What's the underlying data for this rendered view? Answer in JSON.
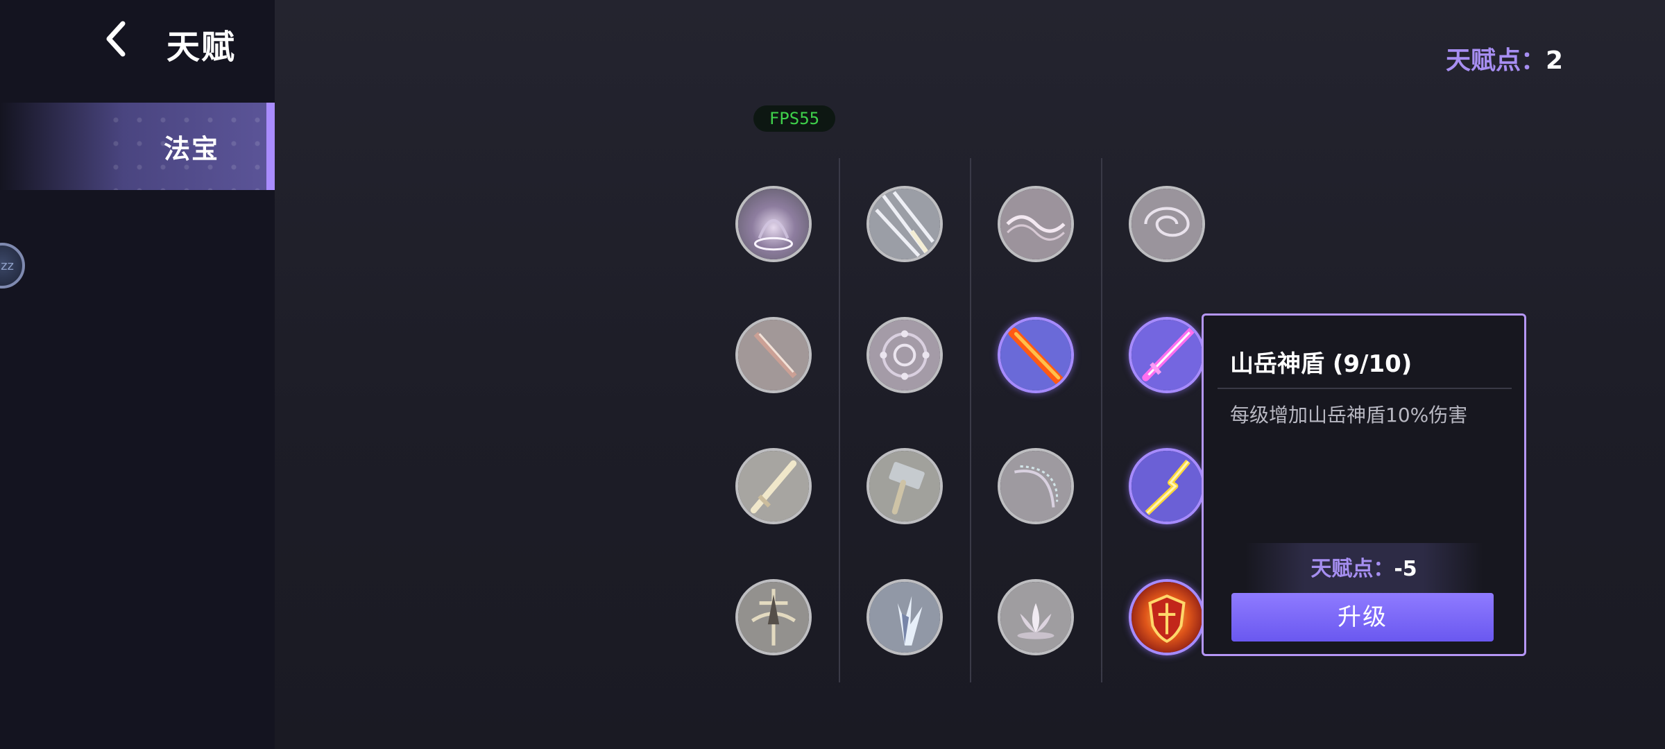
{
  "header": {
    "title": "天赋"
  },
  "sidebar": {
    "tabs": [
      {
        "label": "法宝"
      }
    ],
    "orb_text": "zz"
  },
  "talent_points": {
    "label": "天赋点：",
    "value": "2"
  },
  "fps": "FPS55",
  "nodes": [
    {
      "icon": "purple-vortex-icon",
      "state": "locked"
    },
    {
      "icon": "light-beams-icon",
      "state": "locked"
    },
    {
      "icon": "pink-energy-icon",
      "state": "locked"
    },
    {
      "icon": "swirl-icon",
      "state": "locked"
    },
    {
      "icon": "fire-slash-icon",
      "state": "locked"
    },
    {
      "icon": "purple-seal-icon",
      "state": "locked"
    },
    {
      "icon": "flame-sword-icon",
      "state": "unlocked"
    },
    {
      "icon": "magenta-sword-icon",
      "state": "unlocked"
    },
    {
      "icon": "golden-sword-icon",
      "state": "locked"
    },
    {
      "icon": "hammer-icon",
      "state": "locked"
    },
    {
      "icon": "crescent-wave-icon",
      "state": "locked"
    },
    {
      "icon": "lightning-sword-icon",
      "state": "unlocked"
    },
    {
      "icon": "golden-aura-icon",
      "state": "locked"
    },
    {
      "icon": "blue-burst-icon",
      "state": "locked"
    },
    {
      "icon": "lotus-icon",
      "state": "locked"
    },
    {
      "icon": "mountain-shield-icon",
      "state": "selected"
    }
  ],
  "panel": {
    "title": "山岳神盾 (9/10)",
    "description": "每级增加山岳神盾10%伤害",
    "cost_label": "天赋点：",
    "cost_value": "-5",
    "upgrade_label": "升级"
  },
  "colors": {
    "accent": "#a98cff",
    "button": "#7a68f5",
    "fps": "#3fd14b"
  }
}
